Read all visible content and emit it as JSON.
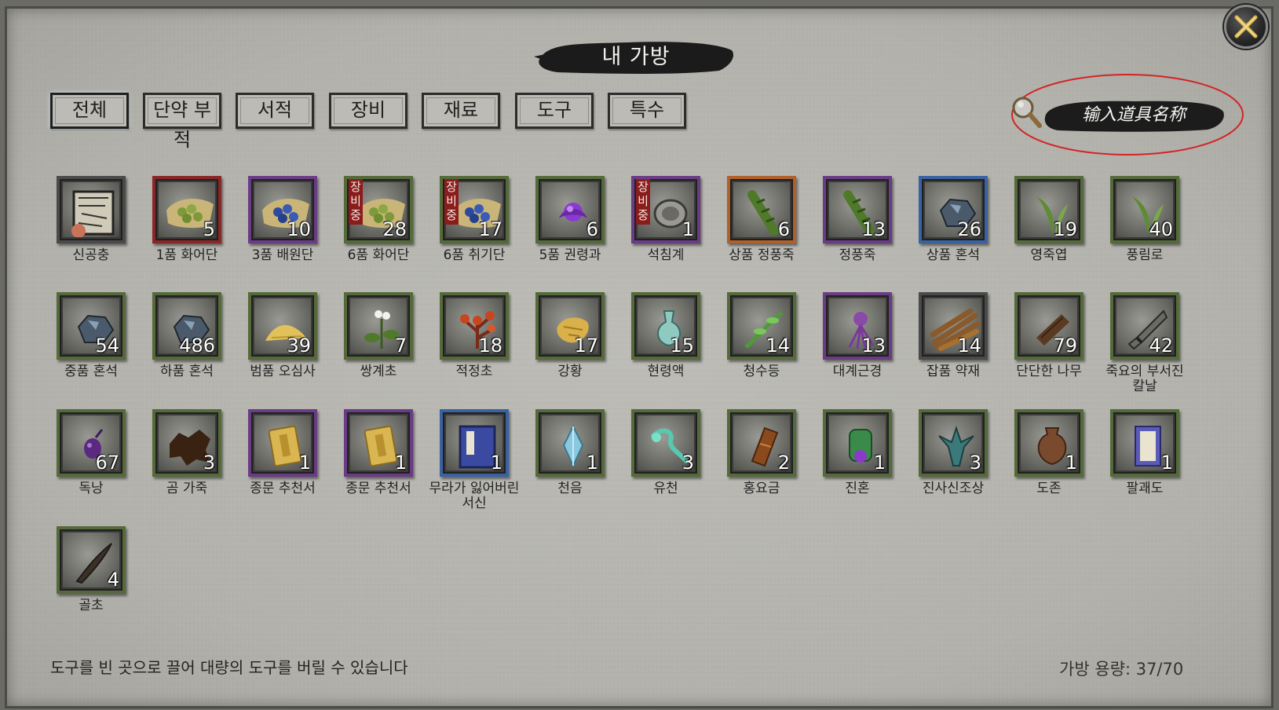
{
  "window": {
    "title": "내 가방"
  },
  "tabs": [
    {
      "label": "전체",
      "active": true
    },
    {
      "label": "단약 부적",
      "active": false
    },
    {
      "label": "서적",
      "active": false
    },
    {
      "label": "장비",
      "active": false
    },
    {
      "label": "재료",
      "active": false
    },
    {
      "label": "도구",
      "active": false
    },
    {
      "label": "특수",
      "active": false
    }
  ],
  "search": {
    "placeholder": "输入道具名称",
    "icon": "magnifier-icon"
  },
  "close": {
    "icon": "crossed-swords-close-icon"
  },
  "equip_badge": [
    "장",
    "비",
    "중"
  ],
  "items": [
    {
      "name": "신공충",
      "count": "",
      "frame": "#4a4a4a",
      "icon": "scroll-map-icon"
    },
    {
      "name": "1품 화어단",
      "count": "5",
      "frame": "#8a2626",
      "icon": "green-pills-on-leaf-icon"
    },
    {
      "name": "3품 배원단",
      "count": "10",
      "frame": "#6a3c86",
      "icon": "blue-pills-on-leaf-icon"
    },
    {
      "name": "6품 화어단",
      "count": "28",
      "frame": "#556a3a",
      "icon": "green-pills-on-leaf-icon",
      "equipped": true
    },
    {
      "name": "6품 취기단",
      "count": "17",
      "frame": "#556a3a",
      "icon": "blue-pills-on-leaf-icon",
      "equipped": true
    },
    {
      "name": "5품 권령과",
      "count": "6",
      "frame": "#556a3a",
      "icon": "purple-fruit-icon"
    },
    {
      "name": "석침계",
      "count": "1",
      "frame": "#6a3c86",
      "icon": "stone-bracelet-icon",
      "equipped": true
    },
    {
      "name": "상품 정풍죽",
      "count": "6",
      "frame": "#b0602a",
      "icon": "bamboo-icon"
    },
    {
      "name": "정풍죽",
      "count": "13",
      "frame": "#6a3c86",
      "icon": "bamboo-icon"
    },
    {
      "name": "상품 혼석",
      "count": "26",
      "frame": "#3a62a0",
      "icon": "soul-stone-icon"
    },
    {
      "name": "영죽엽",
      "count": "19",
      "frame": "#556a3a",
      "icon": "bamboo-leaf-icon"
    },
    {
      "name": "풍림로",
      "count": "40",
      "frame": "#556a3a",
      "icon": "bamboo-leaf-icon"
    },
    {
      "name": "중품 혼석",
      "count": "54",
      "frame": "#556a3a",
      "icon": "soul-stone-icon"
    },
    {
      "name": "하품 혼석",
      "count": "486",
      "frame": "#556a3a",
      "icon": "soul-stone-icon"
    },
    {
      "name": "범품 오심사",
      "count": "39",
      "frame": "#556a3a",
      "icon": "yellow-sand-icon"
    },
    {
      "name": "쌍계초",
      "count": "7",
      "frame": "#556a3a",
      "icon": "herb-flower-icon"
    },
    {
      "name": "적정초",
      "count": "18",
      "frame": "#556a3a",
      "icon": "red-herb-icon"
    },
    {
      "name": "강황",
      "count": "17",
      "frame": "#556a3a",
      "icon": "turmeric-root-icon"
    },
    {
      "name": "현령액",
      "count": "15",
      "frame": "#556a3a",
      "icon": "vase-icon"
    },
    {
      "name": "청수등",
      "count": "14",
      "frame": "#556a3a",
      "icon": "green-vine-icon"
    },
    {
      "name": "대계근경",
      "count": "13",
      "frame": "#6a3c86",
      "icon": "purple-root-icon"
    },
    {
      "name": "잡품 약재",
      "count": "14",
      "frame": "#4a4a4a",
      "icon": "mixed-herbs-icon"
    },
    {
      "name": "단단한 나무",
      "count": "79",
      "frame": "#556a3a",
      "icon": "hard-wood-icon"
    },
    {
      "name": "죽요의 부서진 칼날",
      "count": "42",
      "frame": "#556a3a",
      "icon": "broken-blade-icon"
    },
    {
      "name": "독낭",
      "count": "67",
      "frame": "#556a3a",
      "icon": "poison-sac-icon"
    },
    {
      "name": "곰 가죽",
      "count": "3",
      "frame": "#556a3a",
      "icon": "bear-hide-icon"
    },
    {
      "name": "종문 추천서",
      "count": "1",
      "frame": "#6a3c86",
      "icon": "golden-letter-icon"
    },
    {
      "name": "종문 추천서",
      "count": "1",
      "frame": "#6a3c86",
      "icon": "golden-letter-icon"
    },
    {
      "name": "무라가 잃어버린 서신",
      "count": "1",
      "frame": "#3a62a0",
      "icon": "blue-book-icon"
    },
    {
      "name": "천음",
      "count": "1",
      "frame": "#556a3a",
      "icon": "crystal-icon"
    },
    {
      "name": "유천",
      "count": "3",
      "frame": "#556a3a",
      "icon": "jade-ornament-icon"
    },
    {
      "name": "홍요금",
      "count": "2",
      "frame": "#556a3a",
      "icon": "red-gold-ingot-icon"
    },
    {
      "name": "진혼",
      "count": "1",
      "frame": "#556a3a",
      "icon": "green-seal-icon"
    },
    {
      "name": "진사신조상",
      "count": "3",
      "frame": "#556a3a",
      "icon": "bird-statue-icon"
    },
    {
      "name": "도존",
      "count": "1",
      "frame": "#556a3a",
      "icon": "clay-pot-icon"
    },
    {
      "name": "팔괘도",
      "count": "1",
      "frame": "#556a3a",
      "icon": "scroll-chart-icon"
    },
    {
      "name": "골초",
      "count": "4",
      "frame": "#556a3a",
      "icon": "bone-blade-icon"
    }
  ],
  "footer": {
    "hint": "도구를 빈 곳으로 끌어 대량의 도구를 버릴 수 있습니다",
    "capacity": "가방 용량: 37/70"
  }
}
